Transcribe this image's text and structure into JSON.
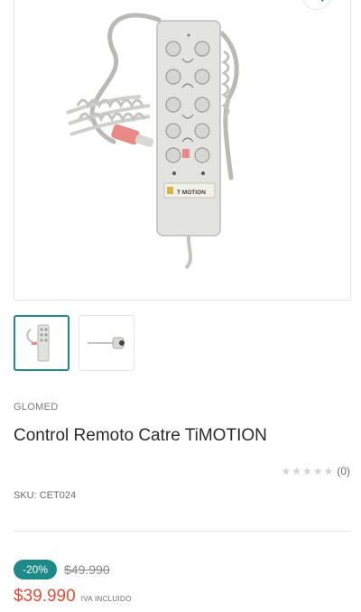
{
  "product": {
    "vendor": "GLOMED",
    "title": "Control Remoto Catre TiMOTION",
    "rating_count": "(0)",
    "rating_value": 0,
    "rating_max": 5,
    "sku": "SKU: CET024",
    "discount_badge": "-20%",
    "compare_price": "$49.990",
    "sale_price": "$39.990",
    "tax_note": "IVA INCLUIDO",
    "remote_brand": "T MOTION"
  },
  "gallery": {
    "thumbnails": [
      {
        "name": "remote-front",
        "active": true
      },
      {
        "name": "cable-connector",
        "active": false
      }
    ]
  },
  "colors": {
    "accent": "#1e8a88",
    "sale": "#e14d35"
  },
  "icons": {
    "zoom": "magnifier-icon",
    "star": "star-icon"
  }
}
